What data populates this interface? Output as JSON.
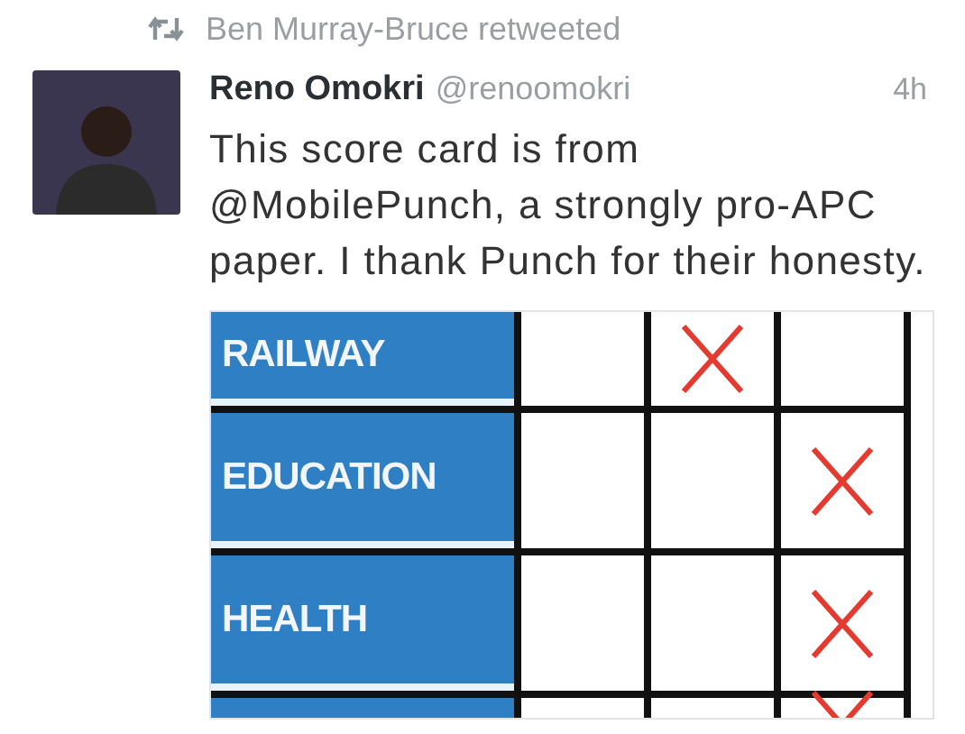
{
  "retweet": {
    "text": "Ben Murray-Bruce retweeted"
  },
  "tweet": {
    "name": "Reno Omokri",
    "handle": "@renoomokri",
    "time": "4h",
    "text": "This score card is from @MobilePunch, a strongly pro-APC paper. I thank Punch for their honesty."
  },
  "scorecard": {
    "rows": [
      {
        "label": "RAILWAY",
        "marks": [
          false,
          true,
          false
        ]
      },
      {
        "label": "EDUCATION",
        "marks": [
          false,
          false,
          true
        ]
      },
      {
        "label": "HEALTH",
        "marks": [
          false,
          false,
          true
        ]
      },
      {
        "marks": [
          false,
          false,
          true
        ]
      }
    ]
  }
}
